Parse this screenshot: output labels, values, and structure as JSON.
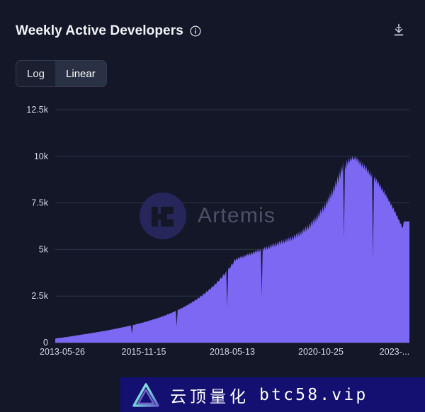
{
  "header": {
    "title": "Weekly Active Developers",
    "info_icon": "info-circle-icon",
    "download_icon": "download-icon"
  },
  "scale_toggle": {
    "options": [
      {
        "label": "Log",
        "active": false
      },
      {
        "label": "Linear",
        "active": true
      }
    ],
    "selected": "Linear"
  },
  "watermark": {
    "text": "Artemis",
    "logo": "artemis-logo"
  },
  "banner": {
    "logo": "penrose-triangle-logo",
    "brand_cn": "云顶量化",
    "url": "btc58.vip",
    "background_color": "#141071"
  },
  "colors": {
    "card_background": "#141728",
    "series_fill": "#7c68f2",
    "grid": "#2e3448",
    "axis_text": "#d6dae6",
    "title_text": "#f2f4f8",
    "toggle_active_bg": "#2b3145"
  },
  "chart_data": {
    "type": "area",
    "title": "Weekly Active Developers",
    "xlabel": "",
    "ylabel": "",
    "scale": "linear",
    "grid": true,
    "legend": null,
    "ylim": [
      0,
      12500
    ],
    "yticks": [
      0,
      2500,
      5000,
      7500,
      10000,
      12500
    ],
    "ytick_labels": [
      "0",
      "2.5k",
      "5k",
      "7.5k",
      "10k",
      "12.5k"
    ],
    "xtick_labels": [
      "2013-05-26",
      "2015-11-15",
      "2018-05-13",
      "2020-10-25",
      "2023-..."
    ],
    "xtick_positions": [
      0,
      0.25,
      0.5,
      0.75,
      0.97
    ],
    "x_start": "2013-05-26",
    "x_end": "2023-...",
    "series": [
      {
        "name": "Weekly Active Developers",
        "color": "#7c68f2",
        "values": [
          210,
          225,
          240,
          235,
          255,
          248,
          262,
          270,
          265,
          280,
          292,
          300,
          288,
          305,
          318,
          330,
          322,
          340,
          352,
          345,
          360,
          375,
          368,
          385,
          398,
          392,
          410,
          425,
          418,
          435,
          448,
          440,
          458,
          470,
          462,
          480,
          495,
          488,
          505,
          520,
          512,
          530,
          545,
          538,
          556,
          570,
          562,
          580,
          595,
          588,
          606,
          620,
          612,
          630,
          648,
          640,
          658,
          675,
          668,
          688,
          705,
          696,
          716,
          735,
          726,
          746,
          765,
          756,
          778,
          798,
          788,
          810,
          830,
          820,
          842,
          862,
          852,
          875,
          896,
          886,
          910,
          932,
          470,
          940,
          962,
          952,
          978,
          1000,
          990,
          1015,
          1040,
          1028,
          1055,
          1080,
          1068,
          1095,
          1120,
          1108,
          1138,
          1165,
          1152,
          1182,
          1210,
          1196,
          1228,
          1258,
          1242,
          1275,
          1308,
          1290,
          1325,
          1358,
          1340,
          1376,
          1412,
          1392,
          1430,
          1468,
          1448,
          1488,
          1528,
          1506,
          1548,
          1590,
          1568,
          1612,
          1655,
          1632,
          1678,
          1722,
          870,
          1745,
          1792,
          1768,
          1818,
          1868,
          1842,
          1895,
          1948,
          1920,
          1978,
          2035,
          2002,
          2062,
          2125,
          2088,
          2152,
          2218,
          2178,
          2245,
          2315,
          2272,
          2345,
          2420,
          2372,
          2450,
          2532,
          2480,
          2562,
          2648,
          2592,
          2680,
          2772,
          2712,
          2805,
          2902,
          2838,
          2938,
          3040,
          2972,
          3078,
          3188,
          3112,
          3225,
          3342,
          3262,
          3382,
          3505,
          3420,
          3548,
          3678,
          3588,
          3722,
          3862,
          1880,
          3908,
          4055,
          3958,
          4112,
          4270,
          4165,
          4328,
          4495,
          4382,
          4552,
          4425,
          4598,
          4465,
          4640,
          4502,
          4680,
          4535,
          4718,
          4572,
          4758,
          4608,
          4798,
          4645,
          4838,
          4682,
          4878,
          4718,
          4918,
          4755,
          4958,
          4792,
          4998,
          4828,
          5038,
          4865,
          5078,
          2480,
          5118,
          4902,
          5158,
          4938,
          5198,
          4975,
          5238,
          5012,
          5278,
          5048,
          5318,
          5085,
          5358,
          5122,
          5398,
          5158,
          5438,
          5195,
          5478,
          5232,
          5518,
          5268,
          5558,
          5305,
          5598,
          5342,
          5638,
          5378,
          5680,
          5418,
          5725,
          5462,
          5775,
          5510,
          5828,
          5562,
          5885,
          5618,
          5948,
          5678,
          6015,
          5742,
          6088,
          5812,
          6165,
          5888,
          6248,
          5968,
          6338,
          6055,
          6432,
          6148,
          6535,
          6248,
          6645,
          6355,
          6762,
          6470,
          6888,
          6592,
          7022,
          6722,
          7165,
          6862,
          7318,
          7010,
          7482,
          7168,
          7655,
          7335,
          7840,
          7512,
          8035,
          7700,
          8242,
          7898,
          8462,
          8108,
          8695,
          8330,
          8940,
          8565,
          9198,
          8812,
          9468,
          9072,
          9745,
          5580,
          9555,
          9262,
          9828,
          9512,
          9902,
          9648,
          9968,
          9742,
          10010,
          9805,
          9845,
          10022,
          9720,
          9960,
          9602,
          9880,
          9500,
          9788,
          9398,
          9688,
          9295,
          9580,
          9188,
          9468,
          9078,
          9348,
          8962,
          9222,
          8842,
          9090,
          4520,
          8718,
          8952,
          8588,
          8810,
          8452,
          8662,
          8312,
          8508,
          8165,
          8348,
          8012,
          8182,
          7852,
          8008,
          7688,
          7828,
          7518,
          7642,
          7342,
          7450,
          7162,
          7252,
          6975,
          7048,
          6782,
          6838,
          6582,
          6622,
          6378,
          6400,
          6168,
          6175,
          6482,
          6525,
          6508,
          6498,
          6512,
          6505,
          6500
        ]
      }
    ]
  }
}
